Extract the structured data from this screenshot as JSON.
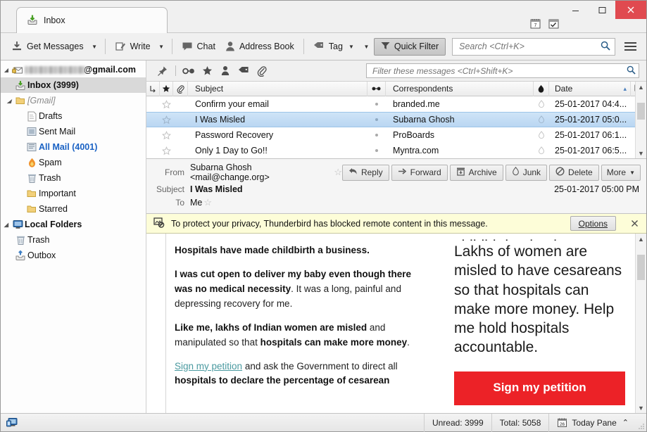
{
  "window": {
    "minimize_label": "—",
    "maximize_label": "□",
    "close_label": "×",
    "close_color": "#e04a50"
  },
  "titlebar_tools": [
    {
      "name": "calendar-icon",
      "label": "Calendar"
    },
    {
      "name": "tasks-icon",
      "label": "Tasks"
    }
  ],
  "tab": {
    "label": "Inbox",
    "icon": "inbox-icon"
  },
  "toolbar": {
    "get_messages": "Get Messages",
    "write": "Write",
    "chat": "Chat",
    "address_book": "Address Book",
    "tag": "Tag",
    "quick_filter": "Quick Filter",
    "dropdown_caret": "▾"
  },
  "search": {
    "placeholder": "Search <Ctrl+K>",
    "value": ""
  },
  "quickfilter_bar": {
    "icons": [
      "pin-icon",
      "unread-icon",
      "starred-icon",
      "contact-icon",
      "tag-icon",
      "attachment-icon"
    ],
    "filter_placeholder": "Filter these messages <Ctrl+Shift+K>",
    "filter_value": ""
  },
  "sidebar": {
    "account": {
      "label": "@gmail.com",
      "blurred": true
    },
    "items": [
      {
        "label": "Inbox (3999)",
        "icon": "inbox-icon",
        "indent": 1,
        "style": "bold",
        "selected": true
      },
      {
        "label": "[Gmail]",
        "icon": "folder-icon",
        "indent": 1,
        "style": "gray-i",
        "selected": false
      },
      {
        "label": "Drafts",
        "icon": "drafts-icon",
        "indent": 2,
        "style": "",
        "selected": false
      },
      {
        "label": "Sent Mail",
        "icon": "sent-icon",
        "indent": 2,
        "style": "",
        "selected": false
      },
      {
        "label": "All Mail (4001)",
        "icon": "allmail-icon",
        "indent": 2,
        "style": "blue",
        "selected": false
      },
      {
        "label": "Spam",
        "icon": "spam-icon",
        "indent": 2,
        "style": "",
        "selected": false
      },
      {
        "label": "Trash",
        "icon": "trash-icon",
        "indent": 2,
        "style": "",
        "selected": false
      },
      {
        "label": "Important",
        "icon": "folder-icon",
        "indent": 2,
        "style": "",
        "selected": false
      },
      {
        "label": "Starred",
        "icon": "folder-icon",
        "indent": 2,
        "style": "",
        "selected": false
      },
      {
        "label": "Local Folders",
        "icon": "local-folders-icon",
        "indent": 0,
        "style": "bold",
        "selected": false
      },
      {
        "label": "Trash",
        "icon": "trash-icon",
        "indent": 1,
        "style": "",
        "selected": false
      },
      {
        "label": "Outbox",
        "icon": "outbox-icon",
        "indent": 1,
        "style": "",
        "selected": false
      }
    ]
  },
  "message_list": {
    "columns": {
      "thread": "thread-icon",
      "star": "star-icon",
      "attachment": "attachment-icon",
      "subject": "Subject",
      "unread": "unread-icon",
      "correspondents": "Correspondents",
      "junk": "junk-icon",
      "date": "Date",
      "sort_arrow": "▴",
      "column_picker": "column-picker-icon"
    },
    "rows": [
      {
        "subject": "Confirm your email",
        "correspondent": "branded.me",
        "date": "25-01-2017 04:4...",
        "selected": false
      },
      {
        "subject": "I Was Misled",
        "correspondent": "Subarna Ghosh",
        "date": "25-01-2017 05:0...",
        "selected": true
      },
      {
        "subject": "Password Recovery",
        "correspondent": "ProBoards",
        "date": "25-01-2017 06:1...",
        "selected": false
      },
      {
        "subject": "Only 1 Day to Go!!",
        "correspondent": "Myntra.com",
        "date": "25-01-2017 06:5...",
        "selected": false
      }
    ]
  },
  "message_header": {
    "from_label": "From",
    "from_value": "Subarna Ghosh <mail@change.org>",
    "subject_label": "Subject",
    "subject_value": "I Was Misled",
    "to_label": "To",
    "to_value": "Me",
    "date": "25-01-2017 05:00 PM",
    "actions": [
      {
        "label": "Reply",
        "icon": "reply-icon"
      },
      {
        "label": "Forward",
        "icon": "forward-icon"
      },
      {
        "label": "Archive",
        "icon": "archive-icon"
      },
      {
        "label": "Junk",
        "icon": "junk-icon"
      },
      {
        "label": "Delete",
        "icon": "delete-icon"
      },
      {
        "label": "More",
        "icon": "chevron-down-icon"
      }
    ]
  },
  "notification": {
    "icon": "blocked-image-icon",
    "text": "To protect your privacy, Thunderbird has blocked remote content in this message.",
    "options_label": "Options",
    "options_accesskey": "O",
    "close_label": "×"
  },
  "email_body": {
    "left_column": [
      {
        "type": "heading",
        "bold": "Hospitals have made childbirth a business."
      },
      {
        "type": "para",
        "bold": "I was cut open to deliver my baby even though there was no medical necessity",
        "rest": ". It was a long, painful and depressing recovery for me."
      },
      {
        "type": "para2",
        "bold1": "Like me, lakhs of Indian women are misled",
        "mid": " and manipulated so that ",
        "bold2": "hospitals can make more money",
        "tail": "."
      },
      {
        "type": "link_para",
        "link": "Sign my petition",
        "mid": " and ask the Government to direct all ",
        "bold": "hospitals to declare the percentage of cesarean"
      }
    ],
    "right_column": {
      "clipped_top": "childbirth a business.",
      "text": "Lakhs of women are misled to have cesareans so that hospitals can make more money. Help me hold hospitals accountable.",
      "button_label": "Sign my petition",
      "button_color": "#ec2227"
    }
  },
  "statusbar": {
    "icon": "connection-icon",
    "unread": "Unread: 3999",
    "total": "Total: 5058",
    "today_pane": "Today Pane",
    "today_pane_icon": "calendar-26-icon",
    "today_pane_caret": "⌃"
  }
}
